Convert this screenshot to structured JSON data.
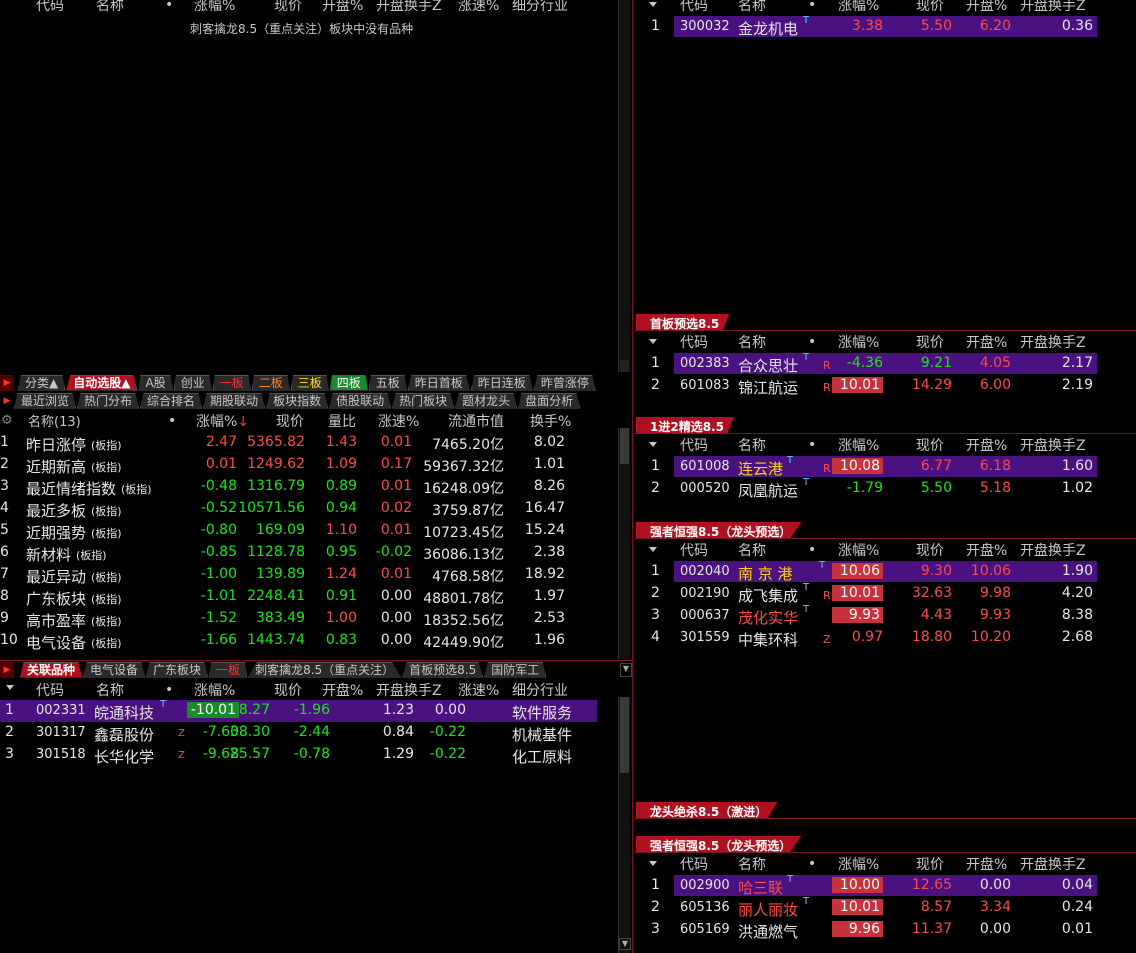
{
  "cols_std": {
    "code": "代码",
    "name": "名称",
    "dot": "•",
    "pct": "涨幅%",
    "price": "现价",
    "open": "开盘%",
    "turn": "开盘换手Z",
    "speed": "涨速%",
    "industry": "细分行业"
  },
  "top_left": {
    "empty_msg": "刺客擒龙8.5（重点关注）板块中没有品种"
  },
  "right_top": {
    "rows": [
      {
        "n": "1",
        "code": "300032",
        "name": "金龙机电",
        "tag": "T",
        "pct": "3.38",
        "price": "5.50",
        "open": "6.20",
        "turn": "0.36"
      }
    ]
  },
  "tabs1": [
    "分类▲",
    "自动选股▲",
    "A股",
    "创业",
    "一板",
    "二板",
    "三板",
    "四板",
    "五板",
    "昨日首板",
    "昨日连板",
    "昨曾涨停"
  ],
  "tabs2": [
    "最近浏览",
    "热门分布",
    "综合排名",
    "期股联动",
    "板块指数",
    "债股联动",
    "热门板块",
    "题材龙头",
    "盘面分析"
  ],
  "board_hdr": {
    "name": "名称(13)",
    "dot": "•",
    "pct": "涨幅%",
    "price": "现价",
    "ratio": "量比",
    "speed": "涨速%",
    "cap": "流通市值",
    "turn": "换手%"
  },
  "board_rows": [
    {
      "n": "1",
      "name": "昨日涨停",
      "sub": "(板指)",
      "pct": "2.47",
      "price": "5365.82",
      "ratio": "1.43",
      "speed": "0.01",
      "cap": "7465.20亿",
      "turn": "8.02"
    },
    {
      "n": "2",
      "name": "近期新高",
      "sub": "(板指)",
      "pct": "0.01",
      "price": "1249.62",
      "ratio": "1.09",
      "speed": "0.17",
      "cap": "59367.32亿",
      "turn": "1.01"
    },
    {
      "n": "3",
      "name": "最近情绪指数",
      "sub": "(板指)",
      "pct": "-0.48",
      "price": "1316.79",
      "ratio": "0.89",
      "speed": "0.01",
      "cap": "16248.09亿",
      "turn": "8.26"
    },
    {
      "n": "4",
      "name": "最近多板",
      "sub": "(板指)",
      "pct": "-0.52",
      "price": "10571.56",
      "ratio": "0.94",
      "speed": "0.02",
      "cap": "3759.87亿",
      "turn": "16.47"
    },
    {
      "n": "5",
      "name": "近期强势",
      "sub": "(板指)",
      "pct": "-0.80",
      "price": "169.09",
      "ratio": "1.10",
      "speed": "0.01",
      "cap": "10723.45亿",
      "turn": "15.24"
    },
    {
      "n": "6",
      "name": "新材料",
      "sub": "(板指)",
      "pct": "-0.85",
      "price": "1128.78",
      "ratio": "0.95",
      "speed": "-0.02",
      "cap": "36086.13亿",
      "turn": "2.38"
    },
    {
      "n": "7",
      "name": "最近异动",
      "sub": "(板指)",
      "pct": "-1.00",
      "price": "139.89",
      "ratio": "1.24",
      "speed": "0.01",
      "cap": "4768.58亿",
      "turn": "18.92"
    },
    {
      "n": "8",
      "name": "广东板块",
      "sub": "(板指)",
      "pct": "-1.01",
      "price": "2248.41",
      "ratio": "0.91",
      "speed": "0.00",
      "cap": "48801.78亿",
      "turn": "1.97"
    },
    {
      "n": "9",
      "name": "高市盈率",
      "sub": "(板指)",
      "pct": "-1.52",
      "price": "383.49",
      "ratio": "1.00",
      "speed": "0.00",
      "cap": "18352.56亿",
      "turn": "2.53"
    },
    {
      "n": "10",
      "name": "电气设备",
      "sub": "(板指)",
      "pct": "-1.66",
      "price": "1443.74",
      "ratio": "0.83",
      "speed": "0.00",
      "cap": "42449.90亿",
      "turn": "1.96"
    }
  ],
  "tabs3": [
    "关联品种",
    "电气设备",
    "广东板块",
    "一板",
    "刺客擒龙8.5（重点关注）",
    "首板预选8.5",
    "国防军工"
  ],
  "bottom_left_rows": [
    {
      "n": "1",
      "code": "002331",
      "name": "皖通科技",
      "tag": "T",
      "pct": "-10.01",
      "price": "8.27",
      "open": "-1.96",
      "turn": "1.23",
      "speed": "0.00",
      "ind": "软件服务"
    },
    {
      "n": "2",
      "code": "301317",
      "name": "鑫磊股份",
      "tag": "Z",
      "pct": "-7.60",
      "price": "38.30",
      "open": "-2.44",
      "turn": "0.84",
      "speed": "-0.22",
      "ind": "机械基件"
    },
    {
      "n": "3",
      "code": "301518",
      "name": "长华化学",
      "tag": "Z",
      "pct": "-9.68",
      "price": "25.57",
      "open": "-0.78",
      "turn": "1.29",
      "speed": "-0.22",
      "ind": "化工原料"
    }
  ],
  "sec1": {
    "title": "首板预选8.5",
    "rows": [
      {
        "n": "1",
        "code": "002383",
        "name": "合众思壮",
        "tag": "T",
        "mark": "R",
        "pct": "-4.36",
        "price": "9.21",
        "open": "4.05",
        "turn": "2.17"
      },
      {
        "n": "2",
        "code": "601083",
        "name": "锦江航运",
        "tag": "",
        "mark": "R",
        "pct": "10.01",
        "price": "14.29",
        "open": "6.00",
        "turn": "2.19"
      }
    ]
  },
  "sec2": {
    "title": "1进2精选8.5",
    "rows": [
      {
        "n": "1",
        "code": "601008",
        "name": "连云港",
        "tag": "T",
        "mark": "R",
        "pct": "10.08",
        "price": "6.77",
        "open": "6.18",
        "turn": "1.60"
      },
      {
        "n": "2",
        "code": "000520",
        "name": "凤凰航运",
        "tag": "T",
        "mark": "",
        "pct": "-1.79",
        "price": "5.50",
        "open": "5.18",
        "turn": "1.02"
      }
    ]
  },
  "sec3": {
    "title": "强者恒强8.5（龙头预选）",
    "rows": [
      {
        "n": "1",
        "code": "002040",
        "name": "南 京 港",
        "tag": "T",
        "mark": "",
        "pct": "10.06",
        "price": "9.30",
        "open": "10.06",
        "turn": "1.90"
      },
      {
        "n": "2",
        "code": "002190",
        "name": "成飞集成",
        "tag": "T",
        "mark": "R",
        "pct": "10.01",
        "price": "32.63",
        "open": "9.98",
        "turn": "4.20"
      },
      {
        "n": "3",
        "code": "000637",
        "name": "茂化实华",
        "tag": "T",
        "mark": "",
        "pct": "9.93",
        "price": "4.43",
        "open": "9.93",
        "turn": "8.38"
      },
      {
        "n": "4",
        "code": "301559",
        "name": "中集环科",
        "tag": "",
        "mark": "Z",
        "pct": "0.97",
        "price": "18.80",
        "open": "10.20",
        "turn": "2.68"
      }
    ]
  },
  "sec4": {
    "title": "龙头绝杀8.5（激进）"
  },
  "sec5": {
    "title": "强者恒强8.5（龙头预选）",
    "rows": [
      {
        "n": "1",
        "code": "002900",
        "name": "哈三联",
        "tag": "T",
        "mark": "",
        "pct": "10.00",
        "price": "12.65",
        "open": "0.00",
        "turn": "0.04"
      },
      {
        "n": "2",
        "code": "605136",
        "name": "丽人丽妆",
        "tag": "T",
        "mark": "",
        "pct": "10.01",
        "price": "8.57",
        "open": "3.34",
        "turn": "0.24"
      },
      {
        "n": "3",
        "code": "605169",
        "name": "洪通燃气",
        "tag": "",
        "mark": "",
        "pct": "9.96",
        "price": "11.37",
        "open": "0.00",
        "turn": "0.01"
      }
    ]
  }
}
